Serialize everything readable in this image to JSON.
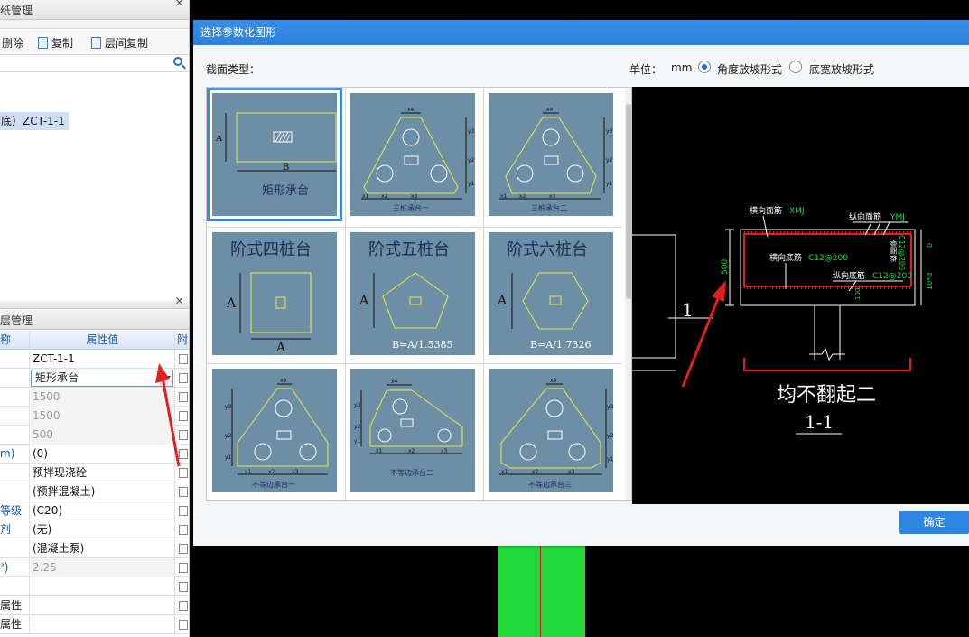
{
  "left_panel": {
    "header_top": "纸管理",
    "toolbar": {
      "delete_label": "删除",
      "copy_label": "复制",
      "floor_copy_label": "层间复制"
    },
    "tree_item": "底）ZCT-1-1",
    "header_mid": "层管理",
    "grid_header": {
      "name": "称",
      "value": "属性值",
      "extra": "附"
    },
    "rows": [
      {
        "name": "",
        "value": "ZCT-1-1",
        "name_blue": false,
        "gray": false
      },
      {
        "name": "",
        "value": "矩形承台",
        "name_blue": false,
        "gray": false,
        "combo": true
      },
      {
        "name": "",
        "value": "1500",
        "name_blue": false,
        "gray": true
      },
      {
        "name": "",
        "value": "1500",
        "name_blue": false,
        "gray": true
      },
      {
        "name": "",
        "value": "500",
        "name_blue": false,
        "gray": true
      },
      {
        "name": "m)",
        "value": "(0)",
        "name_blue": true,
        "gray": false
      },
      {
        "name": "",
        "value": "预拌现浇砼",
        "name_blue": false,
        "gray": false
      },
      {
        "name": "",
        "value": "(预拌混凝土)",
        "name_blue": false,
        "gray": false
      },
      {
        "name": "等级",
        "value": "(C20)",
        "name_blue": true,
        "gray": false
      },
      {
        "name": "剂",
        "value": "(无)",
        "name_blue": true,
        "gray": false
      },
      {
        "name": "",
        "value": "(混凝土泵)",
        "name_blue": false,
        "gray": false
      },
      {
        "name": "²)",
        "value": "2.25",
        "name_blue": true,
        "gray": true
      },
      {
        "name": "",
        "value": "",
        "name_blue": false,
        "gray": false
      },
      {
        "name": "属性",
        "value": "",
        "name_blue": false,
        "gray": false
      },
      {
        "name": "属性",
        "value": "",
        "name_blue": false,
        "gray": false
      }
    ]
  },
  "dialog": {
    "title": "选择参数化图形",
    "section_type_label": "截面类型：",
    "unit_label": "单位：",
    "unit_value": "mm",
    "radio_angle": "角度放坡形式",
    "radio_width": "底宽放坡形式",
    "ok_label": "确定"
  },
  "shapes": {
    "rect_caption": "矩形承台",
    "rect_dim_a": "A",
    "rect_dim_b": "B",
    "three_pile_1": "三桩承台一",
    "three_pile_2": "三桩承台二",
    "step4": "阶式四桩台",
    "step5": "阶式五桩台",
    "step6": "阶式六桩台",
    "dim_a": "A",
    "step5_formula": "B=A/1.5385",
    "step6_formula": "B=A/1.7326",
    "uneq1": "不等边承台一",
    "uneq2": "不等边承台二",
    "uneq3": "不等边承台三",
    "dim_x1": "x1",
    "dim_x2": "x2",
    "dim_x3": "x3",
    "dim_x4": "x4",
    "dim_y1": "y1",
    "dim_y2": "y2",
    "dim_y3": "y3"
  },
  "preview": {
    "top_bar_label": "横向面筋",
    "top_bar_code": "XMJ",
    "long_bar_label": "纵向面筋",
    "long_bar_code": "YMJ",
    "bottom_bar_label": "横向底筋",
    "bottom_bar_code": "C12@200",
    "long_bottom_label": "纵向底筋",
    "long_bottom_code": "C12@200",
    "side_bar_label": "侧面筋",
    "side_bar_code": "C12@200",
    "height": "500",
    "cover_top": "0",
    "cover_side": "10*d",
    "cover_bottom": "100",
    "number_one": "1",
    "caption": "均不翻起二",
    "section_label": "1-1"
  },
  "colors": {
    "accent": "#2f86e2",
    "thumb_bg": "#6d8fa5",
    "cad_green": "#22d83a",
    "cad_red": "#e02020",
    "cad_yellow": "#e8e84a"
  }
}
